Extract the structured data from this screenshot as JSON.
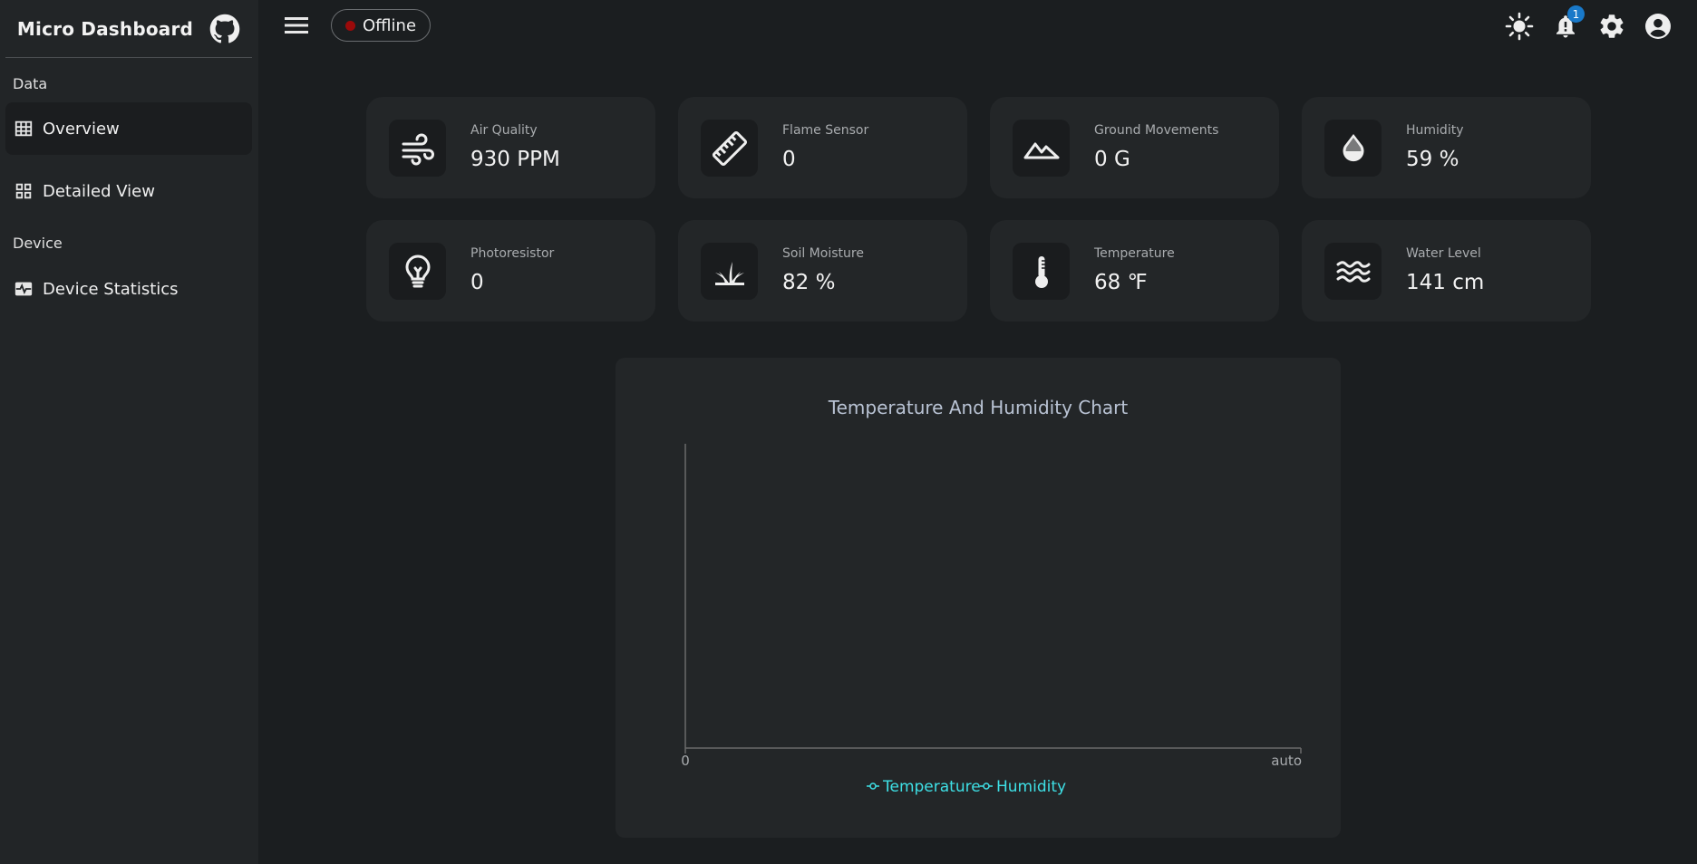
{
  "app": {
    "title": "Micro Dashboard"
  },
  "sidebar": {
    "sections": [
      {
        "label": "Data"
      },
      {
        "label": "Device"
      }
    ],
    "items": [
      {
        "label": "Overview",
        "icon": "table-grid-icon",
        "active": true
      },
      {
        "label": "Detailed View",
        "icon": "dashboard-grid-icon",
        "active": false
      },
      {
        "label": "Device Statistics",
        "icon": "monitor-heart-icon",
        "active": false
      }
    ]
  },
  "header": {
    "status": {
      "label": "Offline",
      "color": "#9b0a0a"
    },
    "notifications_count": "1",
    "icons": [
      "theme-sun-icon",
      "notifications-bell-icon",
      "settings-gear-icon",
      "account-circle-icon"
    ]
  },
  "sensors": [
    {
      "label": "Air Quality",
      "value": "930 PPM",
      "icon": "air-wind-icon"
    },
    {
      "label": "Flame Sensor",
      "value": "0",
      "icon": "ruler-icon"
    },
    {
      "label": "Ground Movements",
      "value": "0 G",
      "icon": "landscape-icon"
    },
    {
      "label": "Humidity",
      "value": "59 %",
      "icon": "water-drop-icon"
    },
    {
      "label": "Photoresistor",
      "value": "0",
      "icon": "lightbulb-icon"
    },
    {
      "label": "Soil Moisture",
      "value": "82 %",
      "icon": "grass-icon"
    },
    {
      "label": "Temperature",
      "value": "68 ℉",
      "icon": "thermometer-icon"
    },
    {
      "label": "Water Level",
      "value": "141 cm",
      "icon": "waves-icon"
    }
  ],
  "chart_data": {
    "type": "line",
    "title": "Temperature And Humidity Chart",
    "x_tick_labels": [
      "0",
      "auto"
    ],
    "series": [
      {
        "name": "Temperature",
        "values": []
      },
      {
        "name": "Humidity",
        "values": []
      }
    ],
    "series_color": "#3ee0e6",
    "legend": "bottom",
    "grid": false
  }
}
